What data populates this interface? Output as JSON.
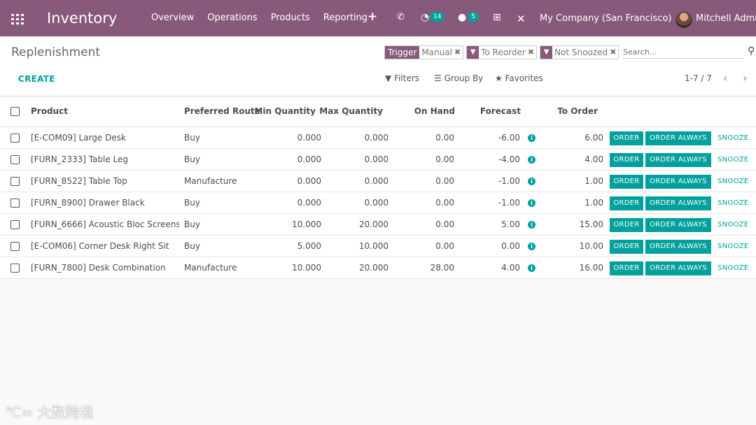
{
  "navbar": {
    "app_title": "Inventory",
    "menu": [
      "Overview",
      "Operations",
      "Products",
      "Reporting"
    ],
    "activity_count": "14",
    "messages_count": "5",
    "company": "My Company (San Francisco)",
    "user": "Mitchell Admin"
  },
  "control": {
    "breadcrumb": "Replenishment",
    "create_label": "CREATE",
    "facets": [
      {
        "label": "Trigger",
        "value": "Manual"
      },
      {
        "value": "To Reorder"
      },
      {
        "value": "Not Snoozed"
      }
    ],
    "search_placeholder": "Search...",
    "filters_label": "Filters",
    "groupby_label": "Group By",
    "favorites_label": "Favorites",
    "pager": "1-7 / 7"
  },
  "table": {
    "columns": [
      "Product",
      "Preferred Route",
      "Min Quantity",
      "Max Quantity",
      "On Hand",
      "Forecast",
      "To Order"
    ],
    "buttons": {
      "order": "ORDER",
      "order_always": "ORDER ALWAYS",
      "snooze": "SNOOZE"
    },
    "rows": [
      {
        "product": "[E-COM09] Large Desk",
        "route": "Buy",
        "min": "0.000",
        "max": "0.000",
        "on_hand": "0.00",
        "forecast": "-6.00",
        "to_order": "6.00"
      },
      {
        "product": "[FURN_2333] Table Leg",
        "route": "Buy",
        "min": "0.000",
        "max": "0.000",
        "on_hand": "0.00",
        "forecast": "-4.00",
        "to_order": "4.00"
      },
      {
        "product": "[FURN_8522] Table Top",
        "route": "Manufacture",
        "min": "0.000",
        "max": "0.000",
        "on_hand": "0.00",
        "forecast": "-1.00",
        "to_order": "1.00"
      },
      {
        "product": "[FURN_8900] Drawer Black",
        "route": "Buy",
        "min": "0.000",
        "max": "0.000",
        "on_hand": "0.00",
        "forecast": "-1.00",
        "to_order": "1.00"
      },
      {
        "product": "[FURN_6666] Acoustic Bloc Screens",
        "route": "Buy",
        "min": "10.000",
        "max": "20.000",
        "on_hand": "0.00",
        "forecast": "5.00",
        "to_order": "15.00"
      },
      {
        "product": "[E-COM06] Corner Desk Right Sit",
        "route": "Buy",
        "min": "5.000",
        "max": "10.000",
        "on_hand": "0.00",
        "forecast": "0.00",
        "to_order": "10.00"
      },
      {
        "product": "[FURN_7800] Desk Combination",
        "route": "Manufacture",
        "min": "10.000",
        "max": "20.000",
        "on_hand": "28.00",
        "forecast": "4.00",
        "to_order": "16.00"
      }
    ]
  },
  "watermark": "大数跨境"
}
